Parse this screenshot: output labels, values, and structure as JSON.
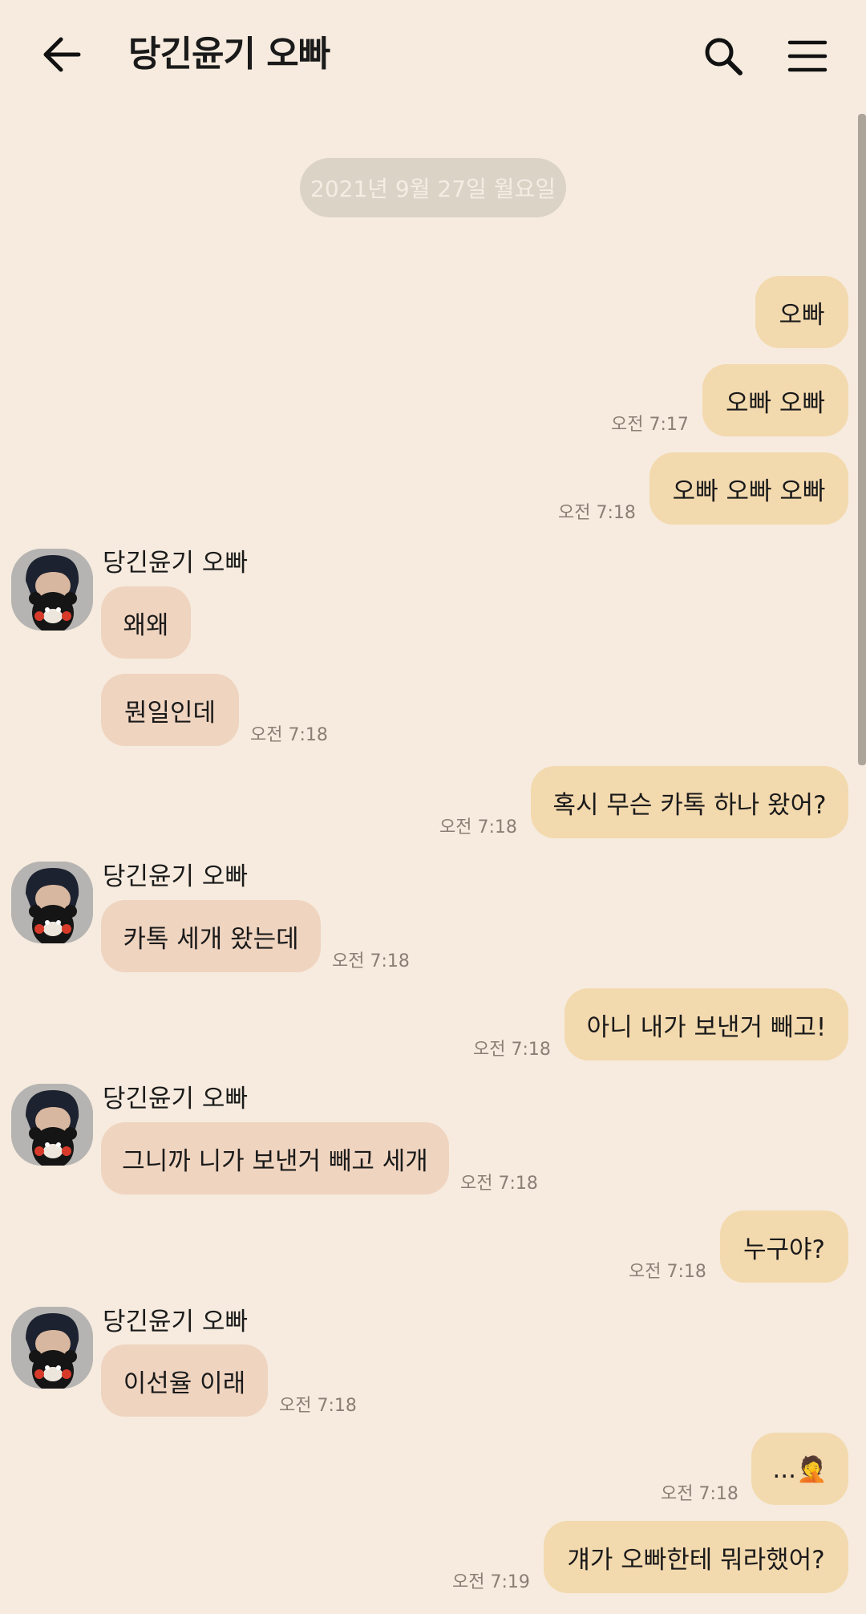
{
  "header": {
    "title": "당긴윤기 오빠",
    "back_icon": "arrow-left-icon",
    "search_icon": "search-icon",
    "menu_icon": "hamburger-menu-icon"
  },
  "chat": {
    "date_divider": "2021년 9월 27일 월요일",
    "sender_name": "당긴윤기 오빠",
    "messages": [
      {
        "from": "me",
        "text": "오빠",
        "time": ""
      },
      {
        "from": "me",
        "text": "오빠 오빠",
        "time": "오전 7:17"
      },
      {
        "from": "me",
        "text": "오빠 오빠 오빠",
        "time": "오전 7:18"
      },
      {
        "from": "other",
        "text": "왜왜",
        "time": ""
      },
      {
        "from": "other",
        "text": "뭔일인데",
        "time": "오전 7:18"
      },
      {
        "from": "me",
        "text": "혹시 무슨 카톡 하나 왔어?",
        "time": "오전 7:18"
      },
      {
        "from": "other",
        "text": "카톡 세개 왔는데",
        "time": "오전 7:18"
      },
      {
        "from": "me",
        "text": "아니 내가 보낸거 빼고!",
        "time": "오전 7:18"
      },
      {
        "from": "other",
        "text": "그니까 니가 보낸거 빼고 세개",
        "time": "오전 7:18"
      },
      {
        "from": "me",
        "text": "누구야?",
        "time": "오전 7:18"
      },
      {
        "from": "other",
        "text": "이선율 이래",
        "time": "오전 7:18"
      },
      {
        "from": "me",
        "text": "...🤦",
        "time": "오전 7:18"
      },
      {
        "from": "me",
        "text": "걔가 오빠한테 뭐라했어?",
        "time": "오전 7:19"
      }
    ]
  },
  "colors": {
    "background": "#f6ebde",
    "my_bubble": "#f3d9ae",
    "other_bubble": "#efd4c0",
    "date_pill": "#dcd3c7",
    "timestamp": "#8a7f74"
  }
}
